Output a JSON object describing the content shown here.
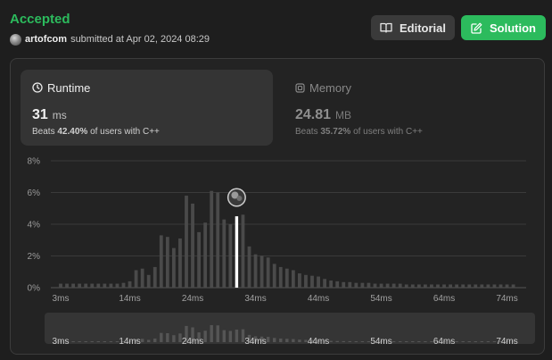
{
  "header": {
    "status": "Accepted",
    "username": "artofcom",
    "submitted_text": "submitted at Apr 02, 2024 08:29",
    "editorial_label": "Editorial",
    "solution_label": "Solution"
  },
  "runtime": {
    "title": "Runtime",
    "value": "31",
    "unit": "ms",
    "beats_prefix": "Beats",
    "beats_pct": "42.40%",
    "beats_suffix": "of users with C++"
  },
  "memory": {
    "title": "Memory",
    "value": "24.81",
    "unit": "MB",
    "beats_prefix": "Beats",
    "beats_pct": "35.72%",
    "beats_suffix": "of users with C++"
  },
  "colors": {
    "accent": "#2cbb5d",
    "bar": "#4a4a4a",
    "highlight": "#ffffff"
  },
  "chart_data": {
    "type": "bar",
    "x": [
      3,
      4,
      5,
      6,
      7,
      8,
      9,
      10,
      11,
      12,
      13,
      14,
      15,
      16,
      17,
      18,
      19,
      20,
      21,
      22,
      23,
      24,
      25,
      26,
      27,
      28,
      29,
      30,
      31,
      32,
      33,
      34,
      35,
      36,
      37,
      38,
      39,
      40,
      41,
      42,
      43,
      44,
      45,
      46,
      47,
      48,
      49,
      50,
      51,
      52,
      53,
      54,
      55,
      56,
      57,
      58,
      59,
      60,
      61,
      62,
      63,
      64,
      65,
      66,
      67,
      68,
      69,
      70,
      71,
      72,
      73,
      74,
      75
    ],
    "values": [
      0.25,
      0.25,
      0.25,
      0.25,
      0.25,
      0.25,
      0.25,
      0.25,
      0.25,
      0.25,
      0.3,
      0.4,
      1.1,
      1.2,
      0.8,
      1.3,
      3.3,
      3.2,
      2.5,
      3.1,
      5.8,
      5.3,
      3.5,
      4.1,
      6.1,
      6.0,
      4.3,
      4.0,
      4.5,
      4.6,
      2.6,
      2.1,
      2.0,
      1.9,
      1.5,
      1.3,
      1.2,
      1.1,
      0.9,
      0.8,
      0.75,
      0.7,
      0.55,
      0.45,
      0.4,
      0.35,
      0.35,
      0.3,
      0.3,
      0.3,
      0.25,
      0.25,
      0.25,
      0.25,
      0.25,
      0.2,
      0.2,
      0.2,
      0.2,
      0.2,
      0.2,
      0.2,
      0.2,
      0.2,
      0.2,
      0.2,
      0.2,
      0.2,
      0.2,
      0.2,
      0.2,
      0.2,
      0.2
    ],
    "highlight_x": 31,
    "yticks": [
      "0%",
      "2%",
      "4%",
      "6%",
      "8%"
    ],
    "ytick_values": [
      0,
      2,
      4,
      6,
      8
    ],
    "ylim": [
      0,
      8
    ],
    "xtick_labels": [
      "3ms",
      "14ms",
      "24ms",
      "34ms",
      "44ms",
      "54ms",
      "64ms",
      "74ms"
    ],
    "xtick_values": [
      3,
      14,
      24,
      34,
      44,
      54,
      64,
      74
    ],
    "grid": true
  }
}
